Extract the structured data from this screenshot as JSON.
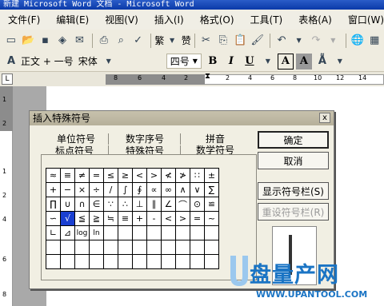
{
  "window": {
    "title": "新建 Microsoft Word 文档 - Microsoft Word"
  },
  "menu": [
    "文件(F)",
    "编辑(E)",
    "视图(V)",
    "插入(I)",
    "格式(O)",
    "工具(T)",
    "表格(A)",
    "窗口(W)"
  ],
  "toolbar": {
    "font_label": "繁",
    "font_label2": "赞"
  },
  "format_bar": {
    "style": "正文 + 一号",
    "font": "宋体",
    "size": "四号",
    "bold": "B",
    "italic": "I",
    "underline": "U",
    "border_a": "A",
    "shade_a": "A"
  },
  "ruler": {
    "corner": "L",
    "dark_ticks": [
      "8",
      "6",
      "4",
      "2"
    ],
    "ticks": [
      "2",
      "4",
      "6",
      "8",
      "10",
      "12",
      "14"
    ]
  },
  "vruler": [
    "1",
    "2",
    "1",
    "2",
    "4",
    "6",
    "8"
  ],
  "dialog": {
    "title": "插入特殊符号",
    "close": "x",
    "tabs": {
      "unit": "单位符号",
      "number": "数字序号",
      "pinyin": "拼音",
      "punct": "标点符号",
      "special": "特殊符号",
      "math": "数学符号"
    },
    "grid": [
      [
        "≈",
        "≡",
        "≠",
        "=",
        "≤",
        "≥",
        "<",
        ">",
        "≮",
        "≯",
        "∷",
        "±"
      ],
      [
        "+",
        "−",
        "×",
        "÷",
        "∕",
        "∫",
        "∮",
        "∝",
        "∞",
        "∧",
        "∨",
        "∑"
      ],
      [
        "∏",
        "∪",
        "∩",
        "∈",
        "∵",
        "∴",
        "⊥",
        "∥",
        "∠",
        "⌒",
        "⊙",
        "≌"
      ],
      [
        "∽",
        "√",
        "≦",
        "≧",
        "≒",
        "≡",
        "+",
        "-",
        "<",
        ">",
        "=",
        "~"
      ],
      [
        "∟",
        "⊿",
        "log",
        "ln",
        "",
        "",
        "",
        "",
        "",
        "",
        "",
        ""
      ],
      [
        "",
        "",
        "",
        "",
        "",
        "",
        "",
        "",
        "",
        "",
        "",
        ""
      ],
      [
        "",
        "",
        "",
        "",
        "",
        "",
        "",
        "",
        "",
        "",
        "",
        ""
      ]
    ],
    "selected": "√",
    "buttons": {
      "ok": "确定",
      "cancel": "取消",
      "show_bar": "显示符号栏(S)",
      "reset_bar": "重设符号栏(R)"
    }
  },
  "watermark": {
    "brand": "盘量产网",
    "url": "WWW.UPANTOOL.COM"
  },
  "colors": {
    "selection": "#1a3fd1",
    "watermark": "#1a74c4"
  }
}
